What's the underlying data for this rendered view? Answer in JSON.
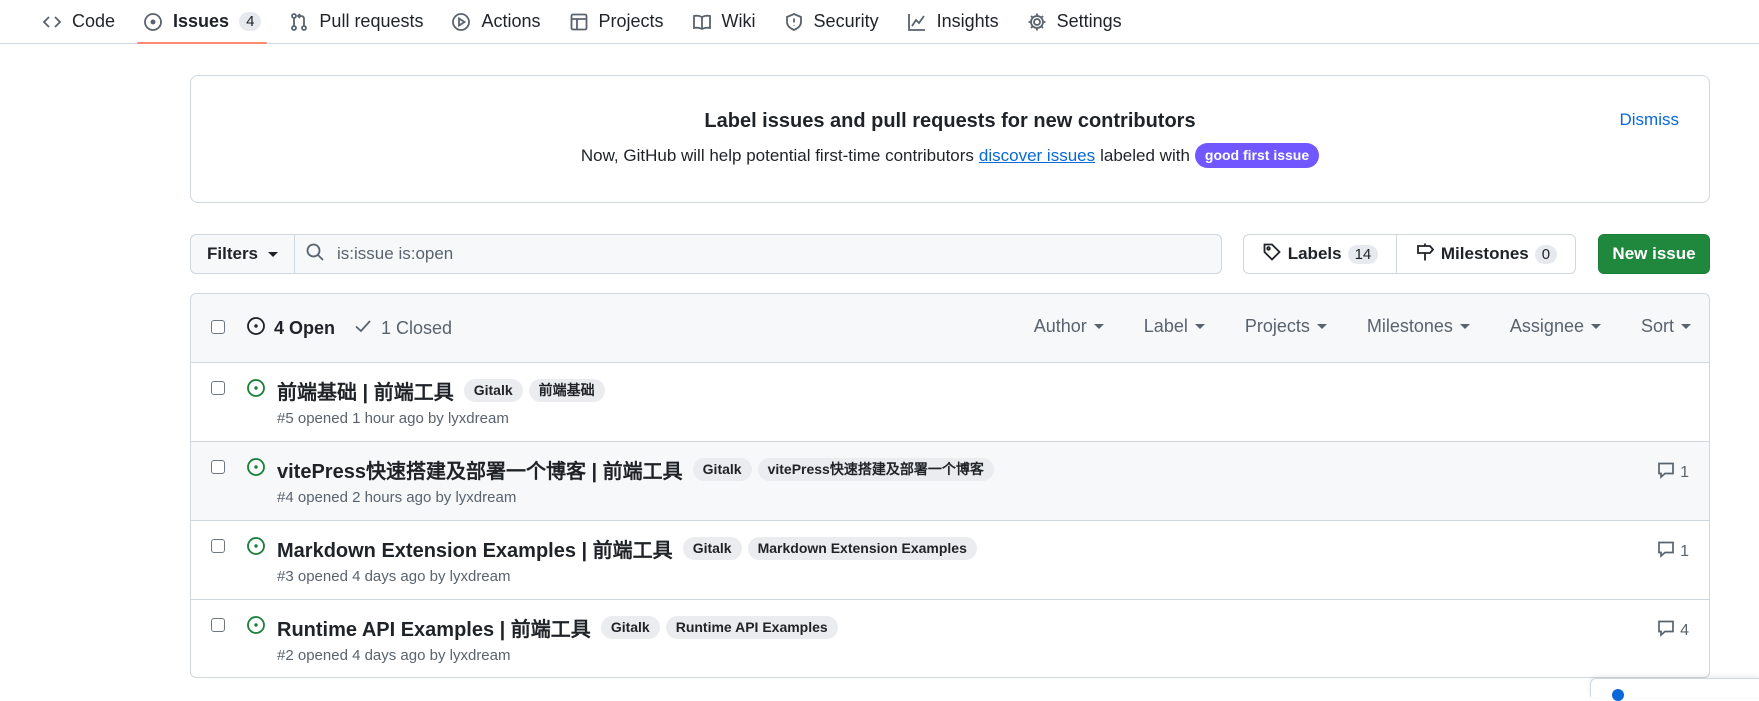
{
  "nav": {
    "tabs": [
      {
        "label": "Code",
        "icon": "code-icon"
      },
      {
        "label": "Issues",
        "icon": "issue-opened-icon",
        "count": "4"
      },
      {
        "label": "Pull requests",
        "icon": "git-pull-request-icon"
      },
      {
        "label": "Actions",
        "icon": "play-icon"
      },
      {
        "label": "Projects",
        "icon": "table-icon"
      },
      {
        "label": "Wiki",
        "icon": "book-icon"
      },
      {
        "label": "Security",
        "icon": "shield-icon"
      },
      {
        "label": "Insights",
        "icon": "graph-icon"
      },
      {
        "label": "Settings",
        "icon": "gear-icon"
      }
    ],
    "selected_tab": "Issues",
    "selected_underline_color": "#fd8c73"
  },
  "banner": {
    "title": "Label issues and pull requests for new contributors",
    "text_before": "Now, GitHub will help potential first-time contributors",
    "link": "discover issues",
    "text_after": "labeled with",
    "label": "good first issue",
    "label_color": "#7057ff",
    "dismiss": "Dismiss"
  },
  "toolbar": {
    "filters_label": "Filters",
    "search_value": "is:issue is:open",
    "labels_label": "Labels",
    "labels_count": "14",
    "milestones_label": "Milestones",
    "milestones_count": "0",
    "new_issue_label": "New issue",
    "new_issue_color": "#1f883d"
  },
  "issues_header": {
    "open_label": "4 Open",
    "closed_label": "1 Closed",
    "filters": [
      "Author",
      "Label",
      "Projects",
      "Milestones",
      "Assignee",
      "Sort"
    ]
  },
  "issues": [
    {
      "title": "前端基础 | 前端工具",
      "labels": [
        "Gitalk",
        "前端基础"
      ],
      "meta": "#5 opened 1 hour ago by lyxdream",
      "comments": ""
    },
    {
      "title": "vitePress快速搭建及部署一个博客 | 前端工具",
      "labels": [
        "Gitalk",
        "vitePress快速搭建及部署一个博客"
      ],
      "meta": "#4 opened 2 hours ago by lyxdream",
      "comments": "1"
    },
    {
      "title": "Markdown Extension Examples | 前端工具",
      "labels": [
        "Gitalk",
        "Markdown Extension Examples"
      ],
      "meta": "#3 opened 4 days ago by lyxdream",
      "comments": "1"
    },
    {
      "title": "Runtime API Examples | 前端工具",
      "labels": [
        "Gitalk",
        "Runtime API Examples"
      ],
      "meta": "#2 opened 4 days ago by lyxdream",
      "comments": "4"
    }
  ],
  "colors": {
    "open_status": "#1a7f37",
    "link": "#0969da",
    "border": "#d0d7de"
  }
}
